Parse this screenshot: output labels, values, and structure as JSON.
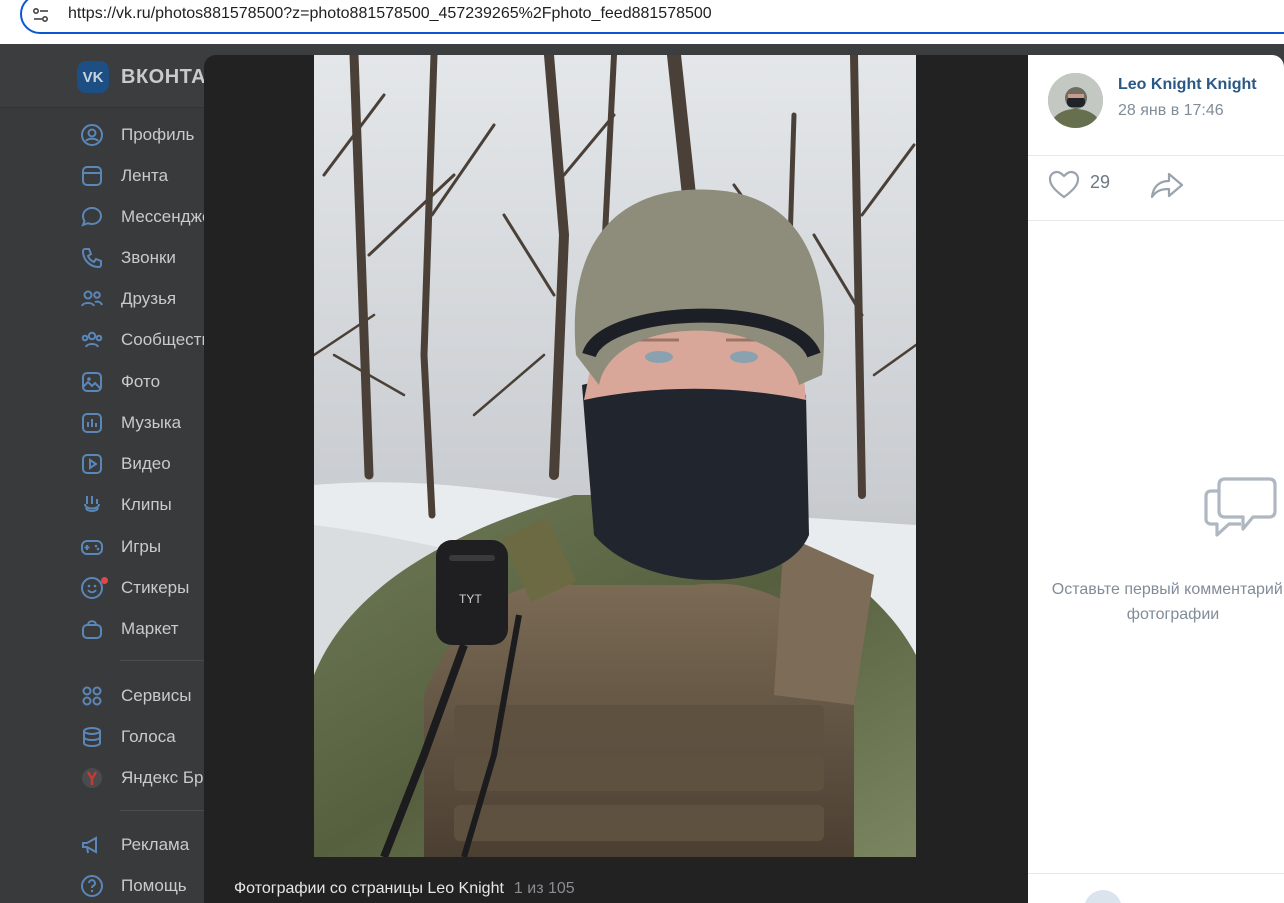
{
  "browser": {
    "url": "https://vk.ru/photos881578500?z=photo881578500_457239265%2Fphoto_feed881578500"
  },
  "vk": {
    "logo_text": "VK",
    "brand_name": "ВКОНТАКТЕ",
    "sidebar": {
      "items": [
        {
          "label": "Профиль",
          "icon": "profile-icon"
        },
        {
          "label": "Лента",
          "icon": "feed-icon"
        },
        {
          "label": "Мессенджер",
          "icon": "messenger-icon"
        },
        {
          "label": "Звонки",
          "icon": "phone-icon"
        },
        {
          "label": "Друзья",
          "icon": "friends-icon"
        },
        {
          "label": "Сообщества",
          "icon": "communities-icon"
        },
        {
          "label": "Фото",
          "icon": "photo-icon"
        },
        {
          "label": "Музыка",
          "icon": "music-icon"
        },
        {
          "label": "Видео",
          "icon": "video-icon"
        },
        {
          "label": "Клипы",
          "icon": "clips-icon"
        },
        {
          "label": "Игры",
          "icon": "games-icon"
        },
        {
          "label": "Стикеры",
          "icon": "stickers-icon"
        },
        {
          "label": "Маркет",
          "icon": "market-icon"
        }
      ],
      "secondary": [
        {
          "label": "Сервисы",
          "icon": "services-icon"
        },
        {
          "label": "Голоса",
          "icon": "votes-icon"
        },
        {
          "label": "Яндекс Браузер",
          "icon": "yandex-icon"
        }
      ],
      "footer": [
        {
          "label": "Реклама",
          "icon": "ads-icon"
        },
        {
          "label": "Помощь",
          "icon": "help-icon"
        }
      ]
    }
  },
  "viewer": {
    "caption": "Фотографии со страницы Leo Knight",
    "counter": "1 из 105"
  },
  "panel": {
    "author": "Leo Knight Knight",
    "date": "28 янв в 17:46",
    "likes": "29",
    "empty_line1": "Оставьте первый комментарий к",
    "empty_line2": "фотографии"
  }
}
